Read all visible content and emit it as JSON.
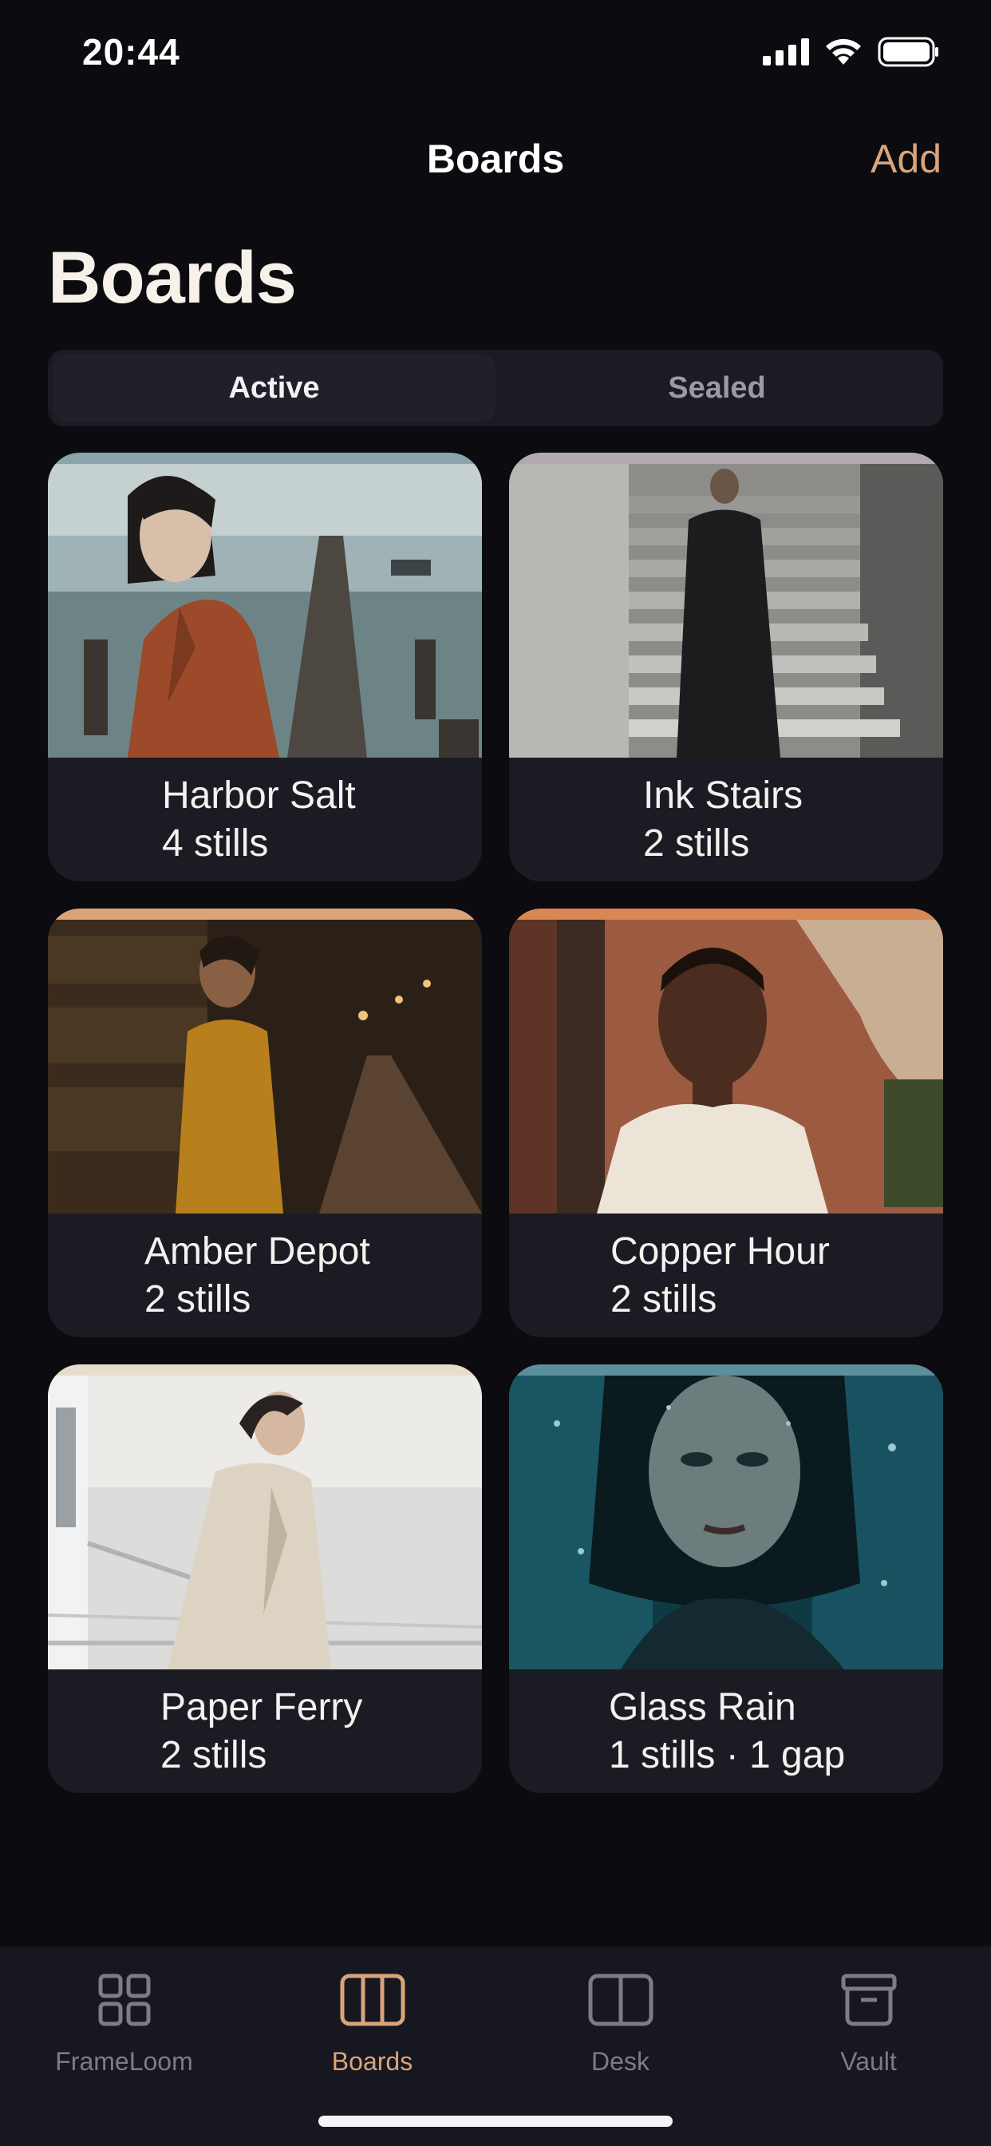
{
  "status_bar": {
    "time": "20:44",
    "icons": [
      "signal-icon",
      "wifi-icon",
      "battery-icon"
    ]
  },
  "nav": {
    "title": "Boards",
    "add_label": "Add"
  },
  "page": {
    "large_title": "Boards"
  },
  "segmented": {
    "options": [
      "Active",
      "Sealed"
    ],
    "selected": "Active"
  },
  "boards": [
    {
      "title": "Harbor Salt",
      "subtitle": "4 stills",
      "accent": "#8aa4ac"
    },
    {
      "title": "Ink Stairs",
      "subtitle": "2 stills",
      "accent": "#b3aab0"
    },
    {
      "title": "Amber Depot",
      "subtitle": "2 stills",
      "accent": "#d9a47a"
    },
    {
      "title": "Copper Hour",
      "subtitle": "2 stills",
      "accent": "#d98755"
    },
    {
      "title": "Paper Ferry",
      "subtitle": "2 stills",
      "accent": "#e8dccc"
    },
    {
      "title": "Glass Rain",
      "subtitle": "1 stills · 1 gap",
      "accent": "#5c8f9c"
    }
  ],
  "tab_bar": {
    "items": [
      {
        "label": "FrameLoom",
        "icon": "grid-icon"
      },
      {
        "label": "Boards",
        "icon": "columns-icon"
      },
      {
        "label": "Desk",
        "icon": "split-panel-icon"
      },
      {
        "label": "Vault",
        "icon": "archive-box-icon"
      }
    ],
    "selected": "Boards"
  },
  "colors": {
    "background": "#0b0b10",
    "accent": "#d9a47a",
    "card": "#1b1b24"
  }
}
